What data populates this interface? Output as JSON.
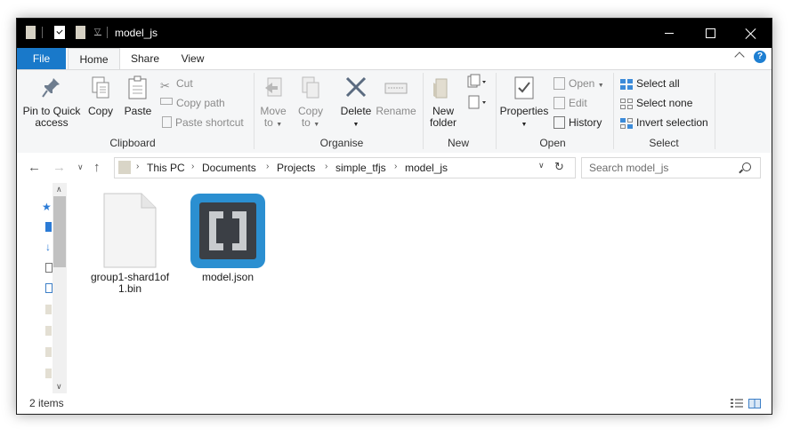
{
  "window": {
    "title": "model_js"
  },
  "ribbon_tabs": [
    {
      "label": "File"
    },
    {
      "label": "Home"
    },
    {
      "label": "Share"
    },
    {
      "label": "View"
    }
  ],
  "help_label": "?",
  "clipboard": {
    "pin_to_quick": "Pin to Quick",
    "pin_access": "access",
    "copy": "Copy",
    "paste": "Paste",
    "cut": "Cut",
    "copy_path": "Copy path",
    "paste_shortcut": "Paste shortcut",
    "group_label": "Clipboard"
  },
  "organise": {
    "move_to_1": "Move",
    "move_to_2": "to",
    "copy_to_1": "Copy",
    "copy_to_2": "to",
    "delete": "Delete",
    "rename": "Rename",
    "group_label": "Organise"
  },
  "new": {
    "new_folder_1": "New",
    "new_folder_2": "folder",
    "group_label": "New"
  },
  "open": {
    "properties": "Properties",
    "open": "Open",
    "edit": "Edit",
    "history": "History",
    "group_label": "Open"
  },
  "select": {
    "select_all": "Select all",
    "select_none": "Select none",
    "invert_selection": "Invert selection",
    "group_label": "Select"
  },
  "address": {
    "crumbs": [
      "This PC",
      "Documents",
      "Projects",
      "simple_tfjs",
      "model_js"
    ]
  },
  "search": {
    "placeholder": "Search model_js"
  },
  "files": [
    {
      "name_line1": "group1-shard1of",
      "name_line2": "1.bin",
      "type": "generic-file-icon"
    },
    {
      "name_line1": "model.json",
      "name_line2": "",
      "type": "brackets-app-icon"
    }
  ],
  "status": {
    "item_count": "2 items"
  },
  "colors": {
    "file_tab": "#1979ca",
    "brackets_blue": "#2b8fd1",
    "brackets_dark": "#3b3f45"
  }
}
